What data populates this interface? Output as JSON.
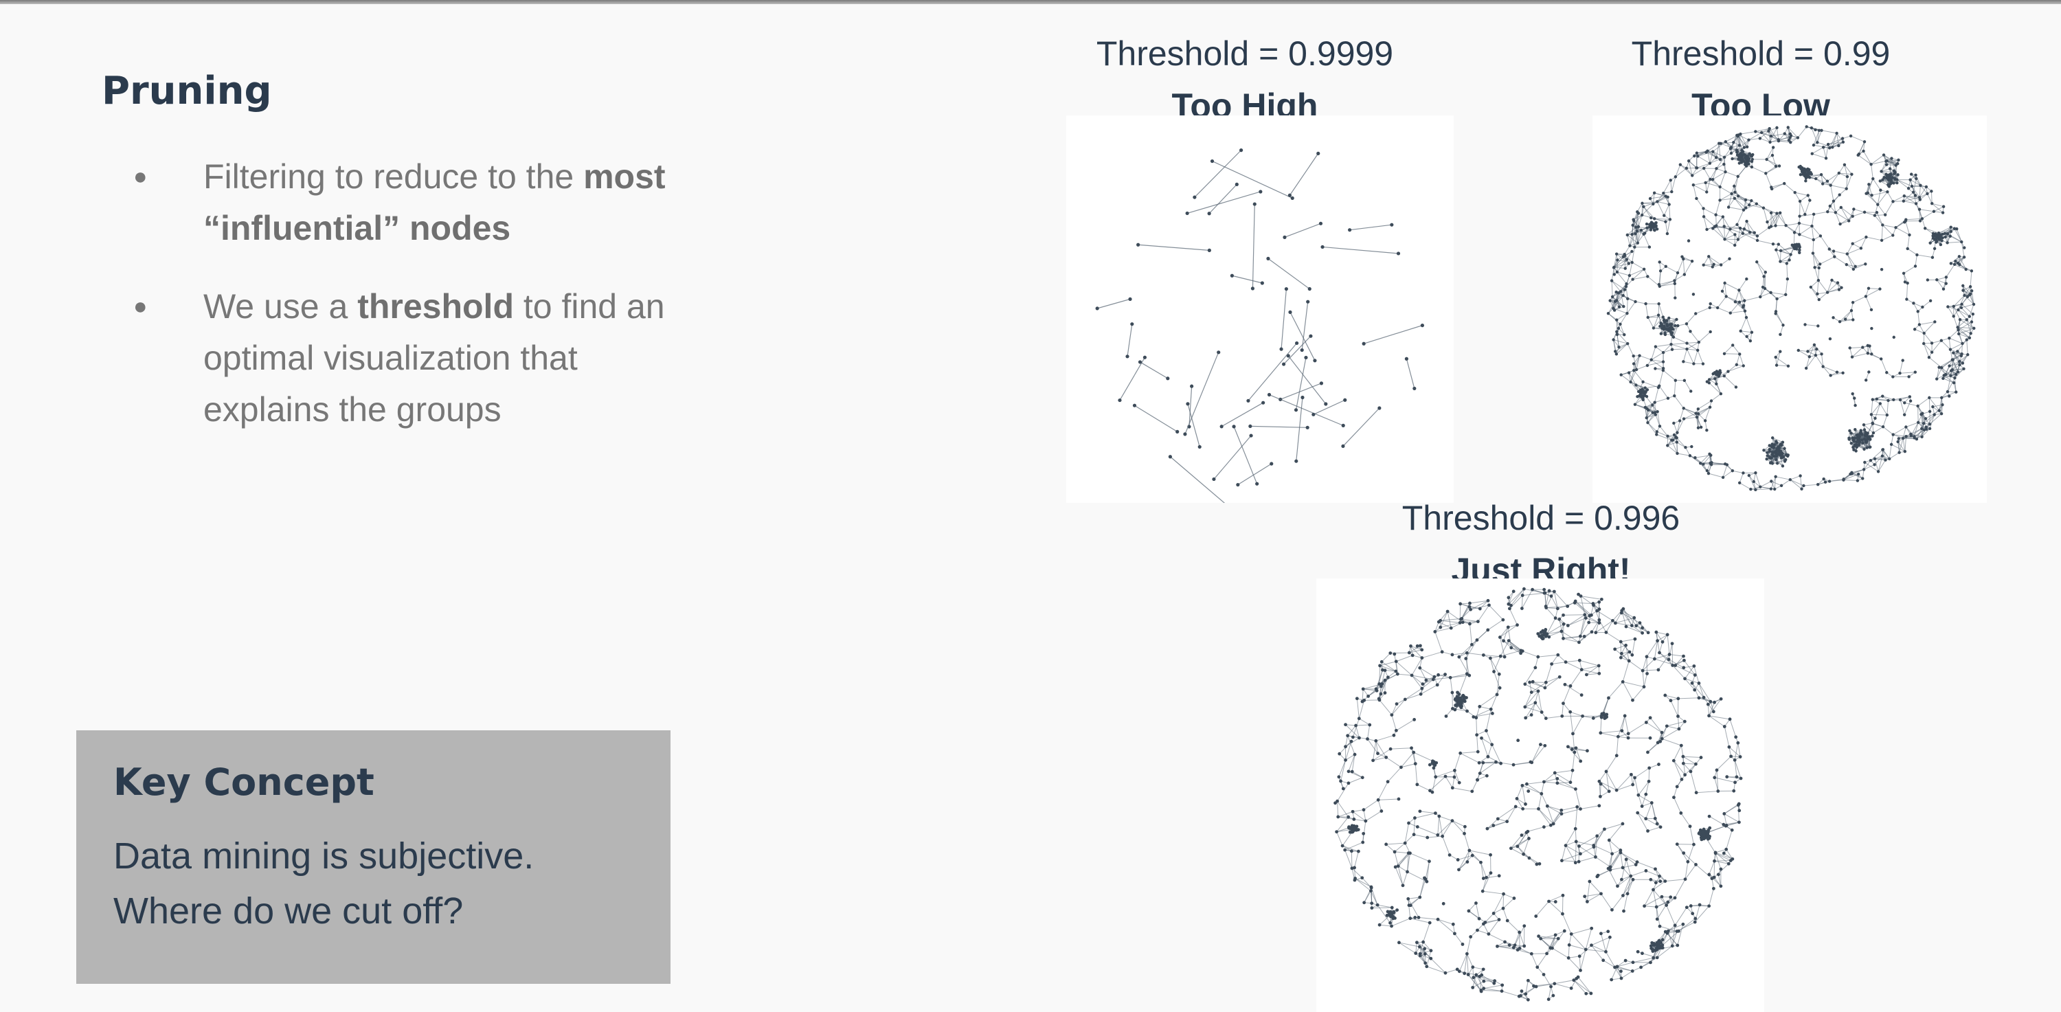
{
  "slide": {
    "title": "Pruning",
    "bullets": [
      {
        "pre": "Filtering to reduce to the ",
        "bold": "most “influential” nodes",
        "post": ""
      },
      {
        "pre": "We use a ",
        "bold": "threshold",
        "post": " to find an optimal visualization that explains the groups"
      }
    ],
    "key_concept": {
      "heading": "Key Concept",
      "text": "Data mining is subjective. Where do we cut off?"
    }
  },
  "panels": [
    {
      "id": "high",
      "threshold_text": "Threshold = 0.9999",
      "verdict": "Too High",
      "threshold": 0.9999,
      "density": "sparse"
    },
    {
      "id": "low",
      "threshold_text": "Threshold = 0.99",
      "verdict": "Too Low",
      "threshold": 0.99,
      "density": "dense"
    },
    {
      "id": "right",
      "threshold_text": "Threshold = 0.996",
      "verdict": "Just Right!",
      "threshold": 0.996,
      "density": "medium"
    }
  ],
  "colors": {
    "node": "#3d4b59",
    "edge": "#5b6875",
    "text": "#2b3b4d",
    "muted": "#777777",
    "box": "#b5b5b5"
  }
}
